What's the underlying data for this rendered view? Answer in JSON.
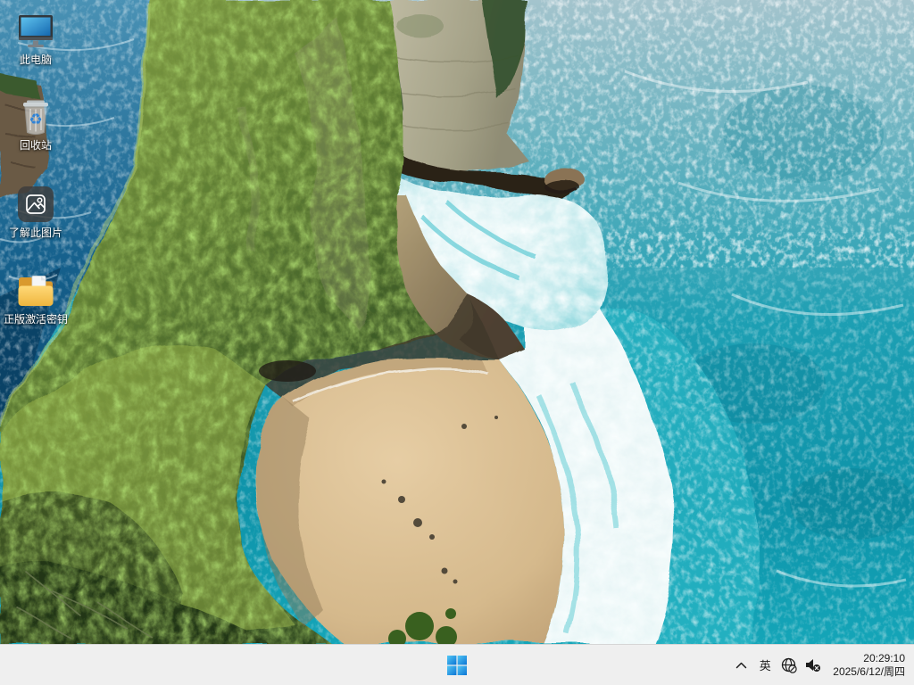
{
  "desktop": {
    "icons": [
      {
        "id": "this-pc",
        "label": "此电脑"
      },
      {
        "id": "recycle-bin",
        "label": "回收站"
      },
      {
        "id": "learn-about-this-picture",
        "label": "了解此图片"
      },
      {
        "id": "genuine-activation-key",
        "label": "正版激活密钥"
      }
    ],
    "wallpaper": {
      "scene": "Aerial view of a green T-rex shaped cliff headland, sandy cove beach and turquoise surf (Kelingking Beach style Windows 11 wallpaper)",
      "palette": {
        "ocean_teal": "#1a9fb3",
        "ocean_deep_blue": "#0c537c",
        "foam_white": "#eef7f8",
        "cliff_green": "#5d7c33",
        "cliff_rock_gray": "#b3af97",
        "sand": "#d8bc8e",
        "sunlit_ridge_green": "#a9c254"
      }
    }
  },
  "taskbar": {
    "start": {
      "id": "start-button",
      "logo": "windows-11-logo"
    },
    "tray": {
      "hidden_icons": "chevron-up",
      "input_language": "英",
      "network_status_icon": "globe-no-internet",
      "volume_status_icon": "speaker-muted"
    },
    "clock": {
      "time": "20:29:10",
      "date": "2025/6/12/周四"
    }
  },
  "theme": {
    "taskbar_bg": "#efefef",
    "taskbar_border": "#d6d6d6",
    "tray_icon_color": "#1d1d1d",
    "clock_text_color": "#1a1a1a",
    "desktop_label_color": "#ffffff",
    "start_logo_top_left": "#54c8f5",
    "start_logo_bottom_right": "#0b74d4"
  }
}
